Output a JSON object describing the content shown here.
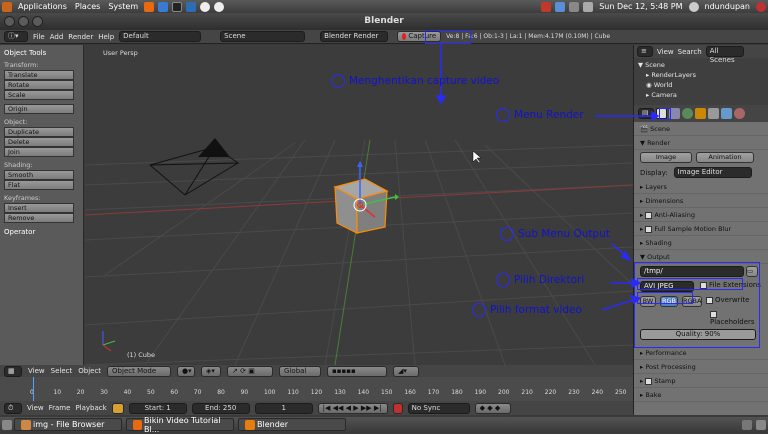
{
  "top_panel": {
    "menus": [
      "Applications",
      "Places",
      "System"
    ],
    "datetime": "Sun Dec 12,  5:48 PM",
    "user": "ndundupan"
  },
  "window_title": "Blender",
  "info_header": {
    "menus": [
      "File",
      "Add",
      "Render",
      "Help"
    ],
    "layout": "Default",
    "scene": "Scene",
    "engine": "Blender Render",
    "capture": "Capture",
    "stats": "Ve:8 | Fa:6 | Ob:1-3 | La:1 | Mem:4.17M (0.10M) | Cube"
  },
  "tools": {
    "title": "Object Tools",
    "transform_label": "Transform:",
    "translate": "Translate",
    "rotate": "Rotate",
    "scale": "Scale",
    "origin": "Origin",
    "object_label": "Object:",
    "duplicate": "Duplicate",
    "delete": "Delete",
    "join": "Join",
    "shading_label": "Shading:",
    "smooth": "Smooth",
    "flat": "Flat",
    "keyframes_label": "Keyframes:",
    "insert": "Insert",
    "remove": "Remove",
    "operator": "Operator"
  },
  "viewport": {
    "title": "User Persp",
    "object": "(1) Cube"
  },
  "view3d_header": {
    "menus": [
      "View",
      "Select",
      "Object"
    ],
    "mode": "Object Mode",
    "orientation": "Global"
  },
  "timeline": {
    "ticks": [
      "0",
      "10",
      "20",
      "30",
      "40",
      "50",
      "60",
      "70",
      "80",
      "90",
      "100",
      "110",
      "120",
      "130",
      "140",
      "150",
      "160",
      "170",
      "180",
      "190",
      "200",
      "210",
      "220",
      "230",
      "240",
      "250"
    ],
    "menus": [
      "View",
      "Frame",
      "Playback"
    ],
    "start": "Start: 1",
    "end": "End: 250",
    "current": "1",
    "sync": "No Sync"
  },
  "outliner": {
    "view": "View",
    "search": "Search",
    "all_scenes": "All Scenes",
    "items": [
      "Scene",
      "RenderLayers",
      "World",
      "Camera"
    ]
  },
  "properties": {
    "context": "Scene",
    "render_panel": "Render",
    "image_btn": "Image",
    "animation_btn": "Animation",
    "display_label": "Display:",
    "display_value": "Image Editor",
    "layers": "Layers",
    "dimensions": "Dimensions",
    "anti_aliasing": "Anti-Aliasing",
    "motion_blur": "Full Sample Motion Blur",
    "shading": "Shading",
    "output": "Output",
    "path": "/tmp/",
    "format": "AVI JPEG",
    "file_extensions": "File Extensions",
    "overwrite": "Overwrite",
    "placeholders": "Placeholders",
    "bw": "BW",
    "rgb": "RGB",
    "rgba": "RGBA",
    "quality": "Quality: 90%",
    "performance": "Performance",
    "post_processing": "Post Processing",
    "stamp": "Stamp",
    "bake": "Bake"
  },
  "taskbar": {
    "items": [
      "img - File Browser",
      "Bikin Video Tutorial Bl...",
      "Blender"
    ]
  },
  "annotations": {
    "stop_capture": "Menghentikan capture video",
    "render_menu": "Menu Render",
    "output_submenu": "Sub Menu Output",
    "choose_dir": "Pilih Direktori",
    "choose_format": "Pilih format video"
  },
  "colors": {
    "annotation": "#2a2aff",
    "object_outline": "#ff8c00",
    "capture_icon": "#e02020"
  }
}
